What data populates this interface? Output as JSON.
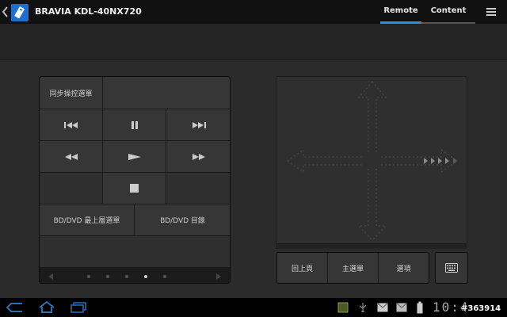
{
  "app": {
    "title": "BRAVIA KDL-40NX720",
    "tabs": [
      {
        "label": "Remote",
        "selected": true
      },
      {
        "label": "Content List",
        "selected": false
      }
    ],
    "accent_color": "#2f8fd6"
  },
  "remote_panel": {
    "sync_menu_label": "同步操控選單",
    "bd_top_menu_label": "BD/DVD 最上層選單",
    "bd_menu_label": "BD/DVD 目錄",
    "transport_icons": [
      "skip-previous-icon",
      "pause-icon",
      "skip-next-icon",
      "rewind-icon",
      "play-icon",
      "fast-forward-icon",
      "stop-icon"
    ],
    "pager": {
      "page_count": 5,
      "current_page": 4
    }
  },
  "touchpad": {
    "icon": "directional-cross-icon"
  },
  "bottom_buttons": {
    "back_label": "回上頁",
    "home_label": "主選單",
    "options_label": "選項",
    "keyboard_icon": "keyboard-icon"
  },
  "system_bar": {
    "time": "10:4",
    "watermark": "#363914"
  }
}
